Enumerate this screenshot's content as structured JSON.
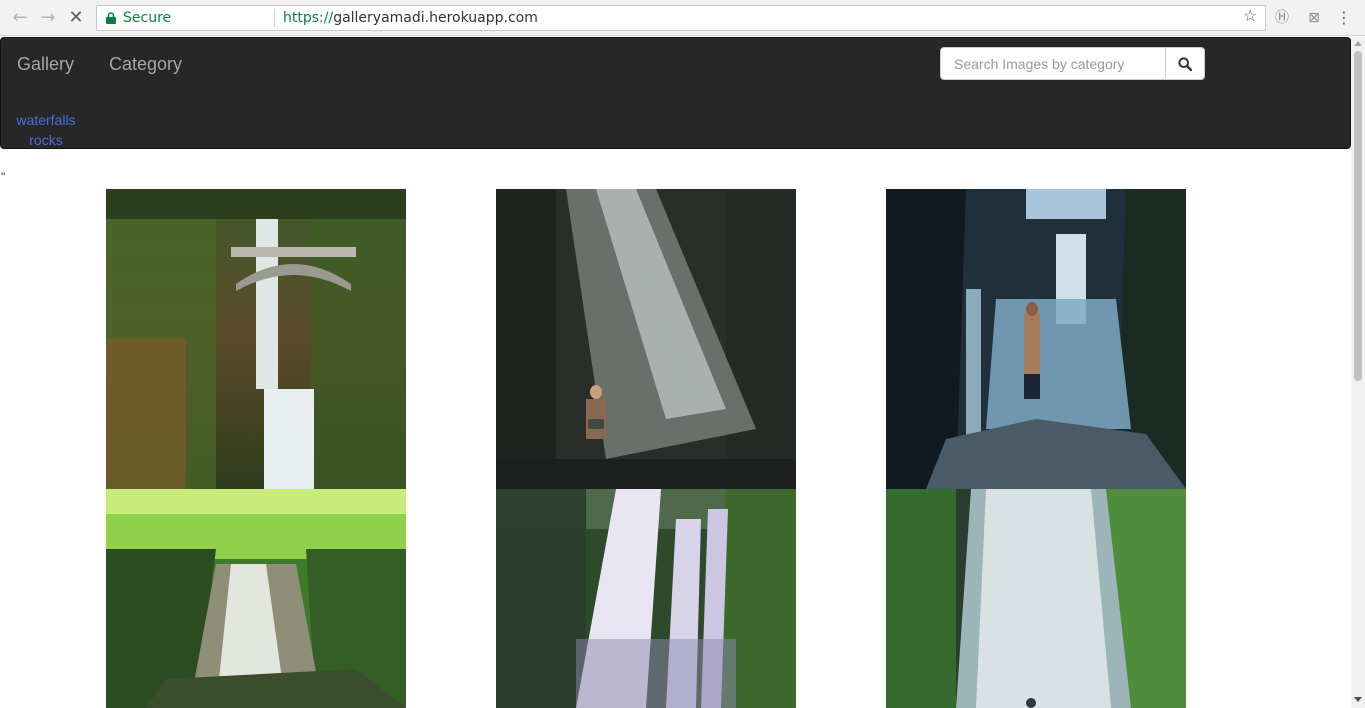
{
  "browser": {
    "secure_label": "Secure",
    "url_scheme": "https://",
    "url_host": "galleryamadi.herokuapp.com",
    "icons": [
      "back-icon",
      "forward-icon",
      "stop-icon",
      "lock-icon",
      "star-icon",
      "extension-icon",
      "extension-icon",
      "menu-icon"
    ]
  },
  "navbar": {
    "brand": "Gallery",
    "category_label": "Category",
    "search_placeholder": "Search Images by category",
    "dropdown": [
      "waterfalls",
      "rocks"
    ]
  },
  "stray_text": "\"",
  "gallery": {
    "category": "waterfalls",
    "photos": [
      {
        "name": "waterfall-bridge-photo",
        "theme": "mossy-bridge"
      },
      {
        "name": "waterfall-person-photo",
        "theme": "dark-rock"
      },
      {
        "name": "waterfall-hiker-photo",
        "theme": "blue-canyon"
      },
      {
        "name": "forest-waterfall-photo",
        "theme": "green-forest"
      },
      {
        "name": "twin-waterfall-photo",
        "theme": "lush-green"
      },
      {
        "name": "canyon-waterfall-photo",
        "theme": "misty-canyon"
      }
    ]
  }
}
